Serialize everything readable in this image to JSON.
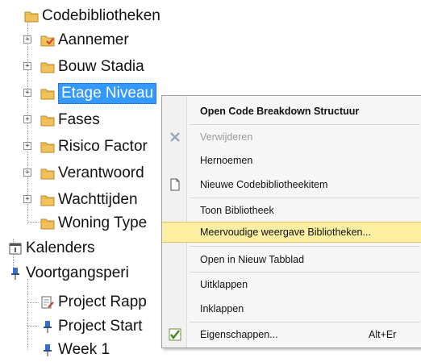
{
  "tree": {
    "root": "Codebibliotheken",
    "libraries": [
      {
        "label": "Aannemer"
      },
      {
        "label": "Bouw Stadia"
      },
      {
        "label": "Etage Niveau",
        "selected": true
      },
      {
        "label": "Fases"
      },
      {
        "label": "Risico Factor"
      },
      {
        "label": "Verantwoord"
      },
      {
        "label": "Wachttijden"
      },
      {
        "label": "Woning Type"
      }
    ],
    "calendars": "Kalenders",
    "progress": "Voortgangsperi",
    "progress_children": [
      "Project Rapp",
      "Project Start",
      "Week 1"
    ]
  },
  "context_menu": {
    "items": [
      {
        "label": "Open Code Breakdown Structuur",
        "bold": true
      },
      {
        "label": "Verwijderen",
        "disabled": true,
        "icon": "delete-icon"
      },
      {
        "label": "Hernoemen"
      },
      {
        "label": "Nieuwe Codebibliotheekitem",
        "icon": "new-document-icon"
      },
      {
        "label": "Toon Bibliotheek"
      },
      {
        "label": "Meervoudige weergave Bibliotheken...",
        "highlighted": true
      },
      {
        "label": "Open in Nieuw Tabblad"
      },
      {
        "label": "Uitklappen"
      },
      {
        "label": "Inklappen"
      },
      {
        "label": "Eigenschappen...",
        "shortcut": "Alt+Er",
        "icon": "checkmark-icon"
      }
    ]
  },
  "colors": {
    "selection": "#3399ff",
    "menu_highlight": "#fcefa1",
    "folder": "#f2c25a"
  }
}
